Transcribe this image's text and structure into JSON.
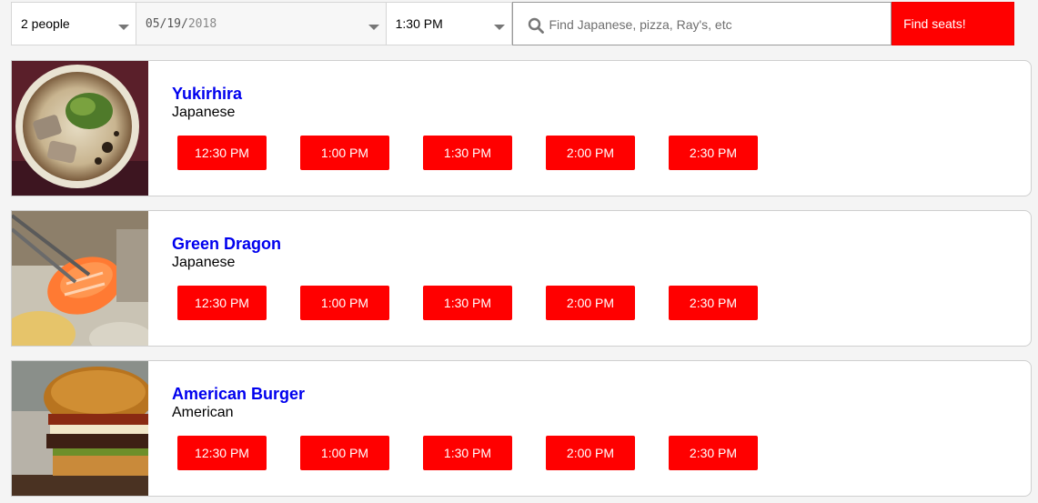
{
  "search": {
    "party_size": "2 people",
    "date_month_day": "05/19/",
    "date_year": "2018",
    "time": "1:30 PM",
    "query_placeholder": "Find Japanese, pizza, Ray's, etc",
    "submit_label": "Find seats!"
  },
  "restaurants": [
    {
      "name": "Yukirhira",
      "cuisine": "Japanese",
      "slots": [
        "12:30 PM",
        "1:00 PM",
        "1:30 PM",
        "2:00 PM",
        "2:30 PM"
      ]
    },
    {
      "name": "Green Dragon",
      "cuisine": "Japanese",
      "slots": [
        "12:30 PM",
        "1:00 PM",
        "1:30 PM",
        "2:00 PM",
        "2:30 PM"
      ]
    },
    {
      "name": "American Burger",
      "cuisine": "American",
      "slots": [
        "12:30 PM",
        "1:00 PM",
        "1:30 PM",
        "2:00 PM",
        "2:30 PM"
      ]
    }
  ],
  "colors": {
    "accent": "#ff0000",
    "link": "#0000ee"
  },
  "icons": {
    "search": "magnifier-icon",
    "dropdown": "caret-down-icon"
  }
}
